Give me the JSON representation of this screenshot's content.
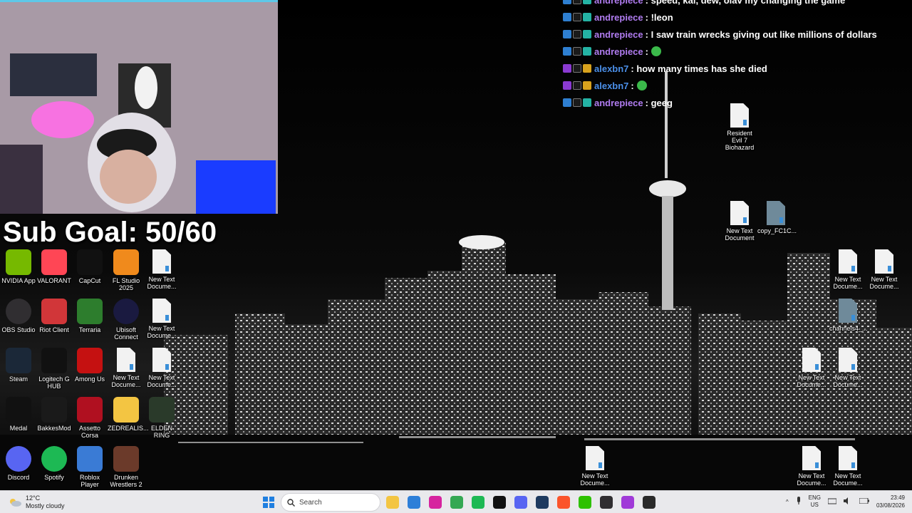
{
  "overlay": {
    "sub_goal": "Sub Goal: 50/60"
  },
  "chat": {
    "messages": [
      {
        "user": "andrepiece",
        "user_color": "#b07cf0",
        "text": ": speed, kai, dew, olav my changing the game",
        "emote": false
      },
      {
        "user": "andrepiece",
        "user_color": "#b07cf0",
        "text": ": !leon",
        "emote": false
      },
      {
        "user": "andrepiece",
        "user_color": "#b07cf0",
        "text": ": I saw train wrecks giving out like millions of dollars",
        "emote": false
      },
      {
        "user": "andrepiece",
        "user_color": "#b07cf0",
        "text": ":",
        "emote": true
      },
      {
        "user": "alexbn7",
        "user_color": "#4b8fe8",
        "text": ": how many times has she died",
        "emote": false
      },
      {
        "user": "alexbn7",
        "user_color": "#4b8fe8",
        "text": ":",
        "emote": true
      },
      {
        "user": "andrepiece",
        "user_color": "#b07cf0",
        "text": ": geeg",
        "emote": false
      }
    ]
  },
  "desktop_icons": [
    {
      "id": "nvidia",
      "label": "NVIDIA App",
      "icon": "nvidia-icon",
      "color": "#76b900"
    },
    {
      "id": "valorant",
      "label": "VALORANT",
      "icon": "valorant-icon",
      "color": "#ff4655"
    },
    {
      "id": "capcut",
      "label": "CapCut",
      "icon": "capcut-icon",
      "color": "#111111"
    },
    {
      "id": "flstudio",
      "label": "FL Studio 2025",
      "icon": "fl-studio-icon",
      "color": "#f08a1c"
    },
    {
      "id": "newtext1",
      "label": "New Text Docume...",
      "icon": "text-file-icon"
    },
    {
      "id": "obs",
      "label": "OBS Studio",
      "icon": "obs-icon",
      "color": "#302e31"
    },
    {
      "id": "riot",
      "label": "Riot Client",
      "icon": "riot-client-icon",
      "color": "#d13639"
    },
    {
      "id": "terraria",
      "label": "Terraria",
      "icon": "terraria-icon",
      "color": "#2d7d2d"
    },
    {
      "id": "ubisoft",
      "label": "Ubisoft Connect",
      "icon": "ubisoft-icon",
      "color": "#1a1a40"
    },
    {
      "id": "newtext2",
      "label": "New Text Docume...",
      "icon": "text-file-icon"
    },
    {
      "id": "steam",
      "label": "Steam",
      "icon": "steam-icon",
      "color": "#1b2838"
    },
    {
      "id": "logitech",
      "label": "Logitech G HUB",
      "icon": "logitech-icon",
      "color": "#111111"
    },
    {
      "id": "amongus",
      "label": "Among Us",
      "icon": "among-us-icon",
      "color": "#c51111"
    },
    {
      "id": "newtext3",
      "label": "New Text Docume...",
      "icon": "text-file-icon"
    },
    {
      "id": "newtext4",
      "label": "New Text Docume...",
      "icon": "text-file-icon"
    },
    {
      "id": "medal",
      "label": "Medal",
      "icon": "medal-icon",
      "color": "#111111"
    },
    {
      "id": "bakkesmod",
      "label": "BakkesMod",
      "icon": "bakkesmod-icon",
      "color": "#1a1a1a"
    },
    {
      "id": "assetto",
      "label": "Assetto Corsa",
      "icon": "assetto-corsa-icon",
      "color": "#b01020"
    },
    {
      "id": "zedrealis",
      "label": "ZEDREALIS...",
      "icon": "folder-icon",
      "color": "#f3c542"
    },
    {
      "id": "eldenring",
      "label": "ELDEN RING",
      "icon": "elden-ring-icon",
      "color": "#2a3a2a"
    },
    {
      "id": "discord",
      "label": "Discord",
      "icon": "discord-icon",
      "color": "#5865f2"
    },
    {
      "id": "spotify",
      "label": "Spotify",
      "icon": "spotify-icon",
      "color": "#1db954"
    },
    {
      "id": "roblox",
      "label": "Roblox Player",
      "icon": "roblox-icon",
      "color": "#3a7bd5"
    },
    {
      "id": "drunken",
      "label": "Drunken Wrestlers 2",
      "icon": "drunken-wrestlers-icon",
      "color": "#6b3a2a"
    },
    {
      "id": "re7",
      "label": "Resident Evil 7 Biohazard",
      "icon": "text-file-icon"
    },
    {
      "id": "newtext5",
      "label": "New Text Document",
      "icon": "text-file-icon"
    },
    {
      "id": "copyfc",
      "label": "copy_FC1C...",
      "icon": "image-file-icon"
    },
    {
      "id": "newtext6",
      "label": "New Text Docume...",
      "icon": "text-file-icon"
    },
    {
      "id": "newtext7",
      "label": "New Text Docume...",
      "icon": "text-file-icon"
    },
    {
      "id": "channels",
      "label": "channels4_...",
      "icon": "image-file-icon"
    },
    {
      "id": "newtext8",
      "label": "New Text Docume...",
      "icon": "text-file-icon"
    },
    {
      "id": "newtext9",
      "label": "New Text Docume...",
      "icon": "text-file-icon"
    },
    {
      "id": "newtext10",
      "label": "New Text Docume...",
      "icon": "text-file-icon"
    },
    {
      "id": "newtext11",
      "label": "New Text Docume...",
      "icon": "text-file-icon"
    },
    {
      "id": "newtext12",
      "label": "New Text Docume...",
      "icon": "text-file-icon"
    }
  ],
  "taskbar": {
    "weather_temp": "12°C",
    "weather_desc": "Mostly cloudy",
    "search_placeholder": "Search",
    "lang_top": "ENG",
    "lang_bottom": "US",
    "time": "23:49",
    "date": "03/08/2026",
    "pinned": [
      {
        "icon": "file-explorer-icon",
        "color": "#f3c542"
      },
      {
        "icon": "microsoft-store-icon",
        "color": "#2d7fd8"
      },
      {
        "icon": "instagram-icon",
        "color": "#d6249f"
      },
      {
        "icon": "chrome-icon",
        "color": "#34a853"
      },
      {
        "icon": "spotify-icon",
        "color": "#1db954"
      },
      {
        "icon": "pc-icon",
        "color": "#111111"
      },
      {
        "icon": "discord-icon",
        "color": "#5865f2"
      },
      {
        "icon": "vivado-icon",
        "color": "#1e3a5f"
      },
      {
        "icon": "brave-icon",
        "color": "#fb542b"
      },
      {
        "icon": "wechat-icon",
        "color": "#2dc100"
      },
      {
        "icon": "obs-icon",
        "color": "#302e31"
      },
      {
        "icon": "app-purple-icon",
        "color": "#a03ad8"
      },
      {
        "icon": "epic-games-icon",
        "color": "#2a2a2a"
      }
    ]
  }
}
